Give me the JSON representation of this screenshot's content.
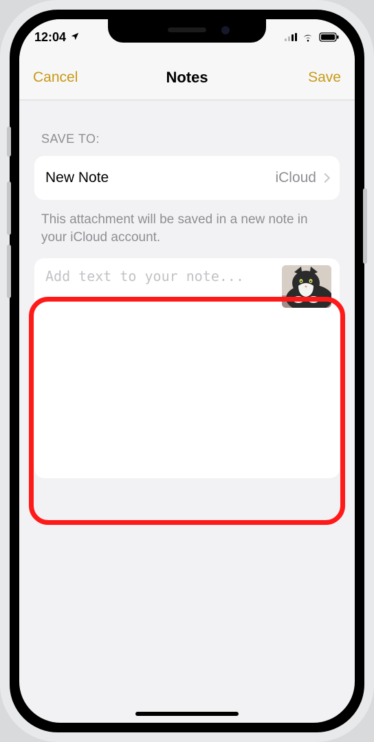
{
  "status": {
    "time": "12:04",
    "location_icon": "location-arrow"
  },
  "nav": {
    "cancel": "Cancel",
    "title": "Notes",
    "save": "Save"
  },
  "sheet": {
    "section_label": "SAVE TO:",
    "row_title": "New Note",
    "row_account": "iCloud",
    "hint": "This attachment will be saved in a new note in your iCloud account.",
    "placeholder": "Add text to your note...",
    "attachment_thumb": "cat-photo"
  },
  "colors": {
    "accent": "#c79a17",
    "secondary": "#8e8e93"
  }
}
